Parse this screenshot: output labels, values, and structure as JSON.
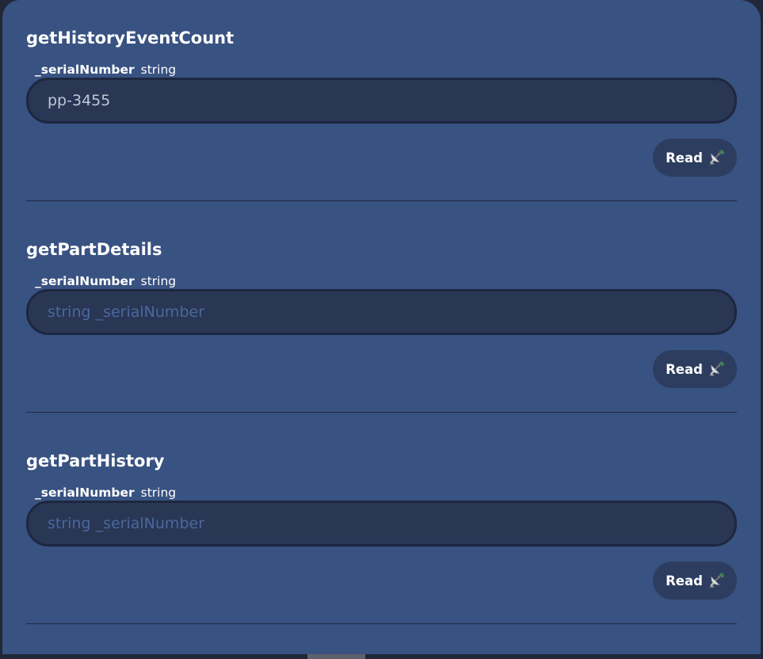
{
  "functions": [
    {
      "name": "getHistoryEventCount",
      "param_name": "_serialNumber",
      "param_type": "string",
      "input_value": "pp-3455",
      "input_placeholder": "string _serialNumber",
      "button_label": "Read",
      "button_icon": "satellite-antenna-icon"
    },
    {
      "name": "getPartDetails",
      "param_name": "_serialNumber",
      "param_type": "string",
      "input_value": "",
      "input_placeholder": "string _serialNumber",
      "button_label": "Read",
      "button_icon": "satellite-antenna-icon"
    },
    {
      "name": "getPartHistory",
      "param_name": "_serialNumber",
      "param_type": "string",
      "input_value": "",
      "input_placeholder": "string _serialNumber",
      "button_label": "Read",
      "button_icon": "satellite-antenna-icon"
    }
  ],
  "colors": {
    "panel_background": "#385281",
    "page_background": "#212638",
    "input_background": "#293654",
    "placeholder_text": "#4a689e",
    "button_background": "#2d3d5f",
    "text": "#ffffff"
  }
}
